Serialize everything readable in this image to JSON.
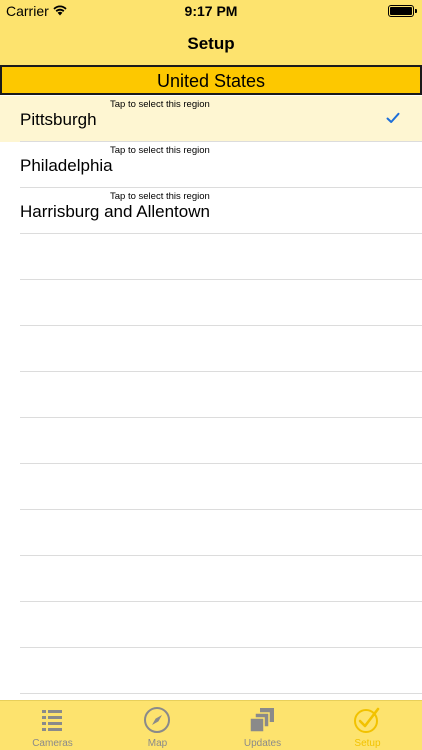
{
  "status_bar": {
    "carrier": "Carrier",
    "time": "9:17 PM"
  },
  "nav": {
    "title": "Setup"
  },
  "section": {
    "header": "United States"
  },
  "regions": [
    {
      "hint": "Tap to select this region",
      "name": "Pittsburgh",
      "selected": true
    },
    {
      "hint": "Tap to select this region",
      "name": "Philadelphia",
      "selected": false
    },
    {
      "hint": "Tap to select this region",
      "name": "Harrisburg and Allentown",
      "selected": false
    }
  ],
  "tabs": [
    {
      "label": "Cameras",
      "icon": "list-icon",
      "active": false
    },
    {
      "label": "Map",
      "icon": "compass-icon",
      "active": false
    },
    {
      "label": "Updates",
      "icon": "stack-icon",
      "active": false
    },
    {
      "label": "Setup",
      "icon": "check-target-icon",
      "active": true
    }
  ],
  "colors": {
    "bar_yellow": "#fde36e",
    "header_gold": "#fdc800",
    "selected_row": "#fef6d2",
    "checkmark_blue": "#1e6fd9",
    "tab_inactive": "#8a8a8a",
    "tab_active": "#f2c200"
  }
}
